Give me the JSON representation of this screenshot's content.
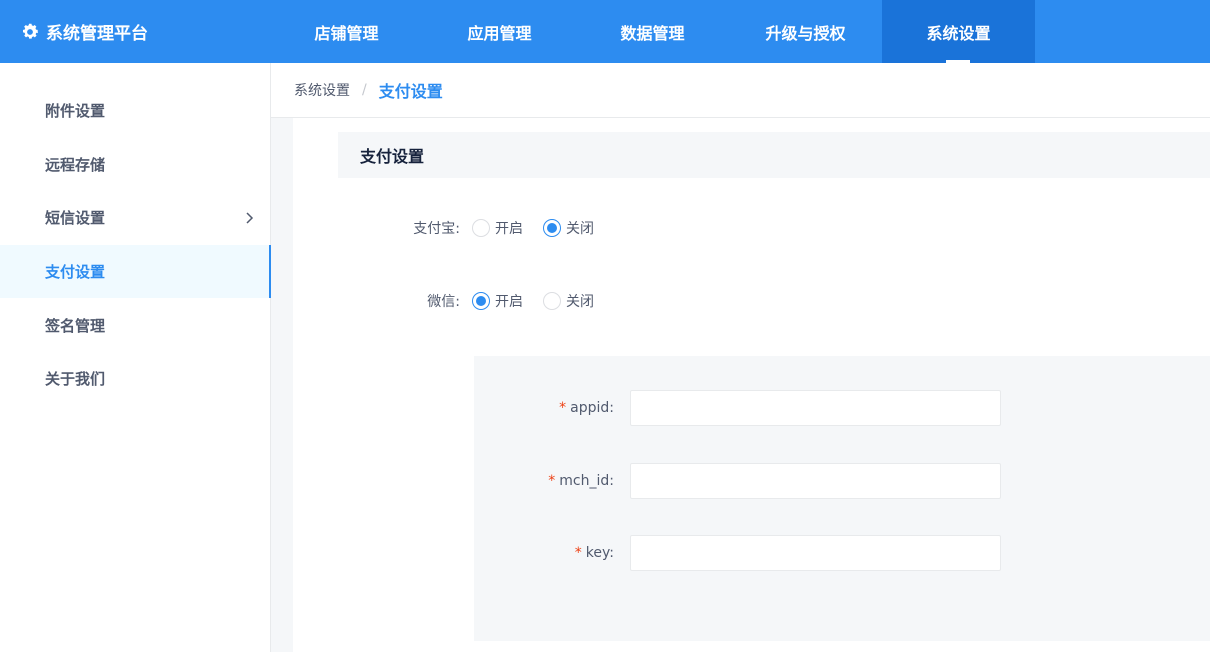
{
  "app": {
    "title": "系统管理平台",
    "logo_icon": "gear-icon"
  },
  "nav": {
    "items": [
      {
        "label": "店铺管理"
      },
      {
        "label": "应用管理"
      },
      {
        "label": "数据管理"
      },
      {
        "label": "升级与授权"
      },
      {
        "label": "系统设置",
        "active": true
      }
    ]
  },
  "sidebar": {
    "items": [
      {
        "label": "附件设置"
      },
      {
        "label": "远程存储"
      },
      {
        "label": "短信设置",
        "has_submenu": true
      },
      {
        "label": "支付设置",
        "active": true
      },
      {
        "label": "签名管理"
      },
      {
        "label": "关于我们"
      }
    ]
  },
  "breadcrumb": {
    "root": "系统设置",
    "separator": "/",
    "current": "支付设置"
  },
  "section": {
    "title": "支付设置"
  },
  "form": {
    "alipay": {
      "label": "支付宝:",
      "on_label": "开启",
      "off_label": "关闭",
      "value": "关闭"
    },
    "wechat": {
      "label": "微信:",
      "on_label": "开启",
      "off_label": "关闭",
      "value": "开启"
    },
    "fields": [
      {
        "label": "appid:",
        "required": true,
        "value": ""
      },
      {
        "label": "mch_id:",
        "required": true,
        "value": ""
      },
      {
        "label": "key:",
        "required": true,
        "value": ""
      }
    ]
  },
  "colors": {
    "primary": "#2d8cf0",
    "nav_active": "#1a73d9",
    "panel_bg": "#f5f7f9",
    "required": "#ed4014"
  }
}
